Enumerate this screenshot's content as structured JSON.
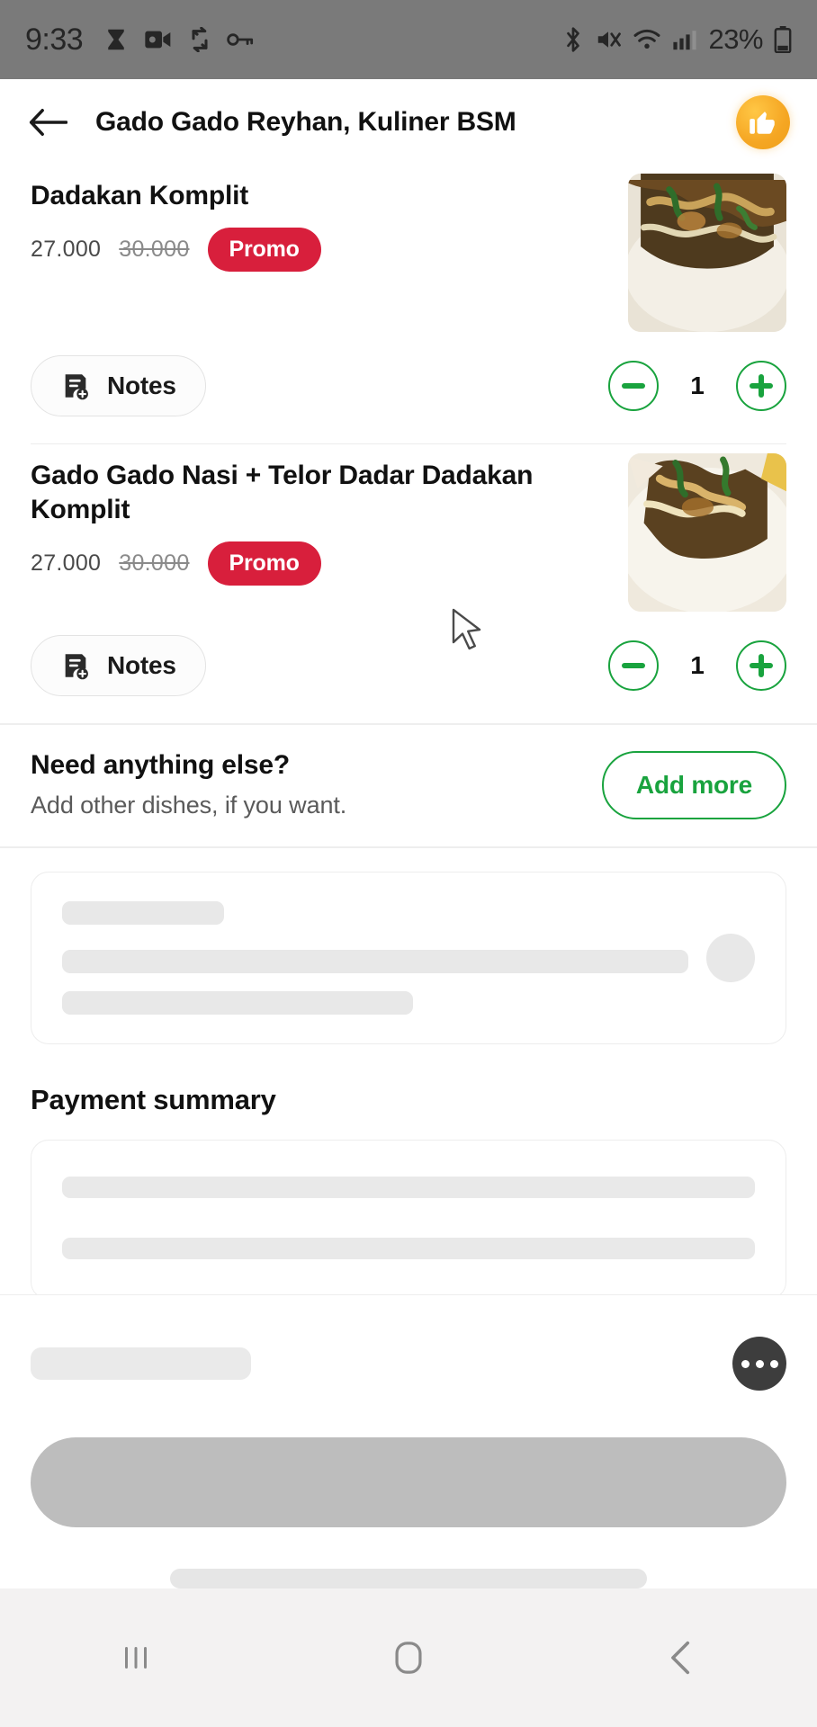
{
  "status_bar": {
    "time": "9:33",
    "battery_percent": "23%",
    "left_icons": [
      "hourglass-icon",
      "video-camera-icon",
      "data-sync-icon",
      "vpn-key-icon"
    ],
    "right_icons": [
      "bluetooth-icon",
      "mute-icon",
      "wifi-icon",
      "cellular-signal-icon",
      "battery-icon"
    ],
    "background_color": "#7a7a7a"
  },
  "header": {
    "back_icon": "arrow-left-icon",
    "title": "Gado Gado Reyhan, Kuliner BSM",
    "badge_icon": "thumbs-up-icon",
    "badge_color": "#f5a623"
  },
  "cart": {
    "items": [
      {
        "title": "Dadakan Komplit",
        "price_current": "27.000",
        "price_original": "30.000",
        "promo_label": "Promo",
        "notes_label": "Notes",
        "notes_icon": "note-add-icon",
        "quantity": "1",
        "decrease_icon": "minus-icon",
        "increase_icon": "plus-icon",
        "thumbnail_alt": "gado-gado-dish-photo"
      },
      {
        "title": "Gado Gado Nasi + Telor Dadar Dadakan Komplit",
        "price_current": "27.000",
        "price_original": "30.000",
        "promo_label": "Promo",
        "notes_label": "Notes",
        "notes_icon": "note-add-icon",
        "quantity": "1",
        "decrease_icon": "minus-icon",
        "increase_icon": "plus-icon",
        "thumbnail_alt": "gado-gado-telor-dadar-photo"
      }
    ]
  },
  "upsell": {
    "title": "Need anything else?",
    "subtitle": "Add other dishes, if you want.",
    "button_label": "Add more",
    "button_color": "#19a33e"
  },
  "payment": {
    "section_title": "Payment summary"
  },
  "bottom_bar": {
    "more_icon": "more-horizontal-icon",
    "cta_state": "loading-disabled"
  },
  "nav_bar": {
    "recents_icon": "recents-icon",
    "home_icon": "home-icon",
    "back_icon": "back-chevron-icon"
  },
  "colors": {
    "promo_red": "#d81f3c",
    "brand_green": "#19a33e",
    "badge_orange": "#f5a623",
    "skeleton_gray": "#e8e8e8"
  },
  "cursor": {
    "icon": "mouse-pointer-icon"
  }
}
